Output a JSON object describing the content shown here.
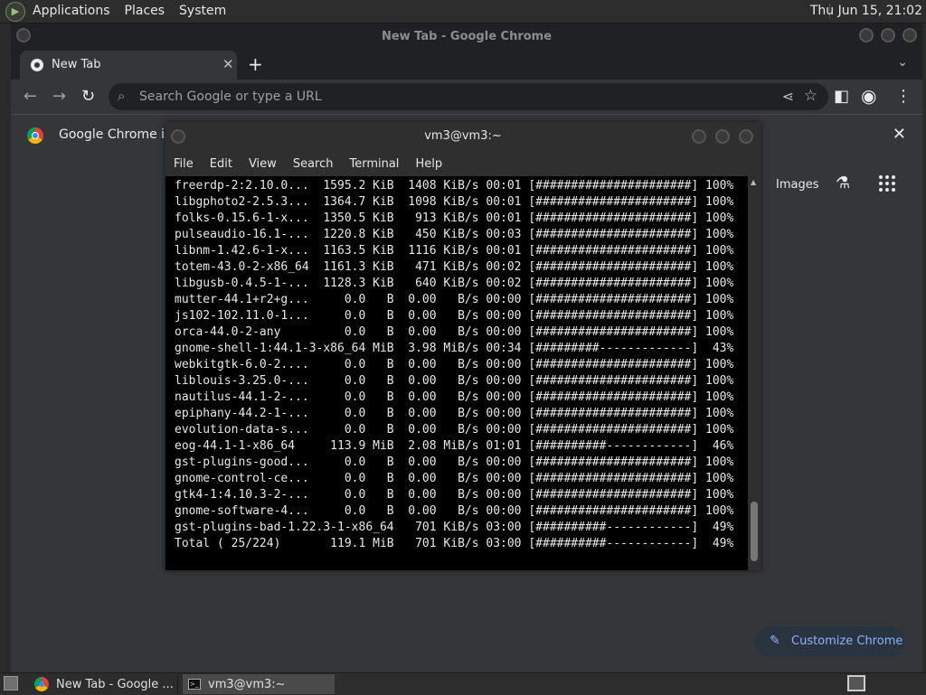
{
  "top_panel": {
    "menus": [
      "Applications",
      "Places",
      "System"
    ],
    "clock": "Thu Jun 15, 21:02"
  },
  "chrome": {
    "window_title": "New Tab - Google Chrome",
    "tab_label": "New Tab",
    "omnibox_placeholder": "Search Google or type a URL",
    "infobar_text": "Google Chrome isn",
    "images_link": "Images",
    "customize_label": "Customize Chrome"
  },
  "terminal": {
    "title": "vm3@vm3:~",
    "menus": [
      "File",
      "Edit",
      "View",
      "Search",
      "Terminal",
      "Help"
    ],
    "lines": [
      "freerdp-2:2.10.0...  1595.2 KiB  1408 KiB/s 00:01 [######################] 100%",
      "libgphoto2-2.5.3...  1364.7 KiB  1098 KiB/s 00:01 [######################] 100%",
      "folks-0.15.6-1-x...  1350.5 KiB   913 KiB/s 00:01 [######################] 100%",
      "pulseaudio-16.1-...  1220.8 KiB   450 KiB/s 00:03 [######################] 100%",
      "libnm-1.42.6-1-x...  1163.5 KiB  1116 KiB/s 00:01 [######################] 100%",
      "totem-43.0-2-x86_64  1161.3 KiB   471 KiB/s 00:02 [######################] 100%",
      "libgusb-0.4.5-1-...  1128.3 KiB   640 KiB/s 00:02 [######################] 100%",
      "mutter-44.1+r2+g...     0.0   B  0.00   B/s 00:00 [######################] 100%",
      "js102-102.11.0-1...     0.0   B  0.00   B/s 00:00 [######################] 100%",
      "orca-44.0-2-any         0.0   B  0.00   B/s 00:00 [######################] 100%",
      "gnome-shell-1:44.1-3-x86_64 MiB  3.98 MiB/s 00:34 [#########-------------]  43%",
      "webkitgtk-6.0-2....     0.0   B  0.00   B/s 00:00 [######################] 100%",
      "liblouis-3.25.0-...     0.0   B  0.00   B/s 00:00 [######################] 100%",
      "nautilus-44.1-2-...     0.0   B  0.00   B/s 00:00 [######################] 100%",
      "epiphany-44.2-1-...     0.0   B  0.00   B/s 00:00 [######################] 100%",
      "evolution-data-s...     0.0   B  0.00   B/s 00:00 [######################] 100%",
      "eog-44.1-1-x86_64     113.9 MiB  2.08 MiB/s 01:01 [##########------------]  46%",
      "gst-plugins-good...     0.0   B  0.00   B/s 00:00 [######################] 100%",
      "gnome-control-ce...     0.0   B  0.00   B/s 00:00 [######################] 100%",
      "gtk4-1:4.10.3-2-...     0.0   B  0.00   B/s 00:00 [######################] 100%",
      "gnome-software-4...     0.0   B  0.00   B/s 00:00 [######################] 100%",
      "gst-plugins-bad-1.22.3-1-x86_64   701 KiB/s 03:00 [##########------------]  49%",
      "Total ( 25/224)       119.1 MiB   701 KiB/s 03:00 [##########------------]  49%"
    ]
  },
  "taskbar": {
    "chrome_task": "New Tab - Google ...",
    "terminal_task": "vm3@vm3:~"
  }
}
